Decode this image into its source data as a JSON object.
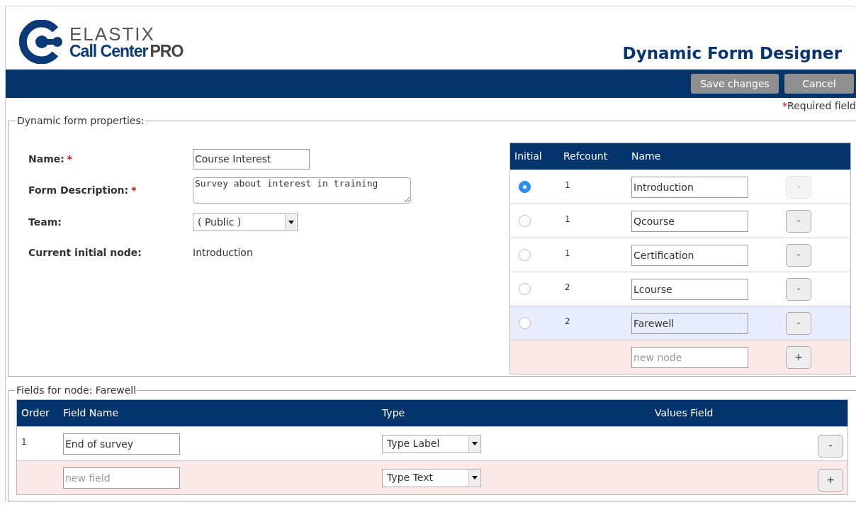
{
  "logo": {
    "brand": "ELASTIX",
    "product": "Call Center",
    "edition": "PRO"
  },
  "title": "Dynamic Form Designer",
  "buttons": [
    {
      "label": "Save changes",
      "kind": "save"
    },
    {
      "label": "Cancel",
      "kind": "cancel"
    }
  ],
  "required_note": {
    "mark": "*",
    "text": "Required field"
  },
  "properties": {
    "legend": "Dynamic form properties:",
    "fields": [
      {
        "kind": "text",
        "label": "Name:",
        "required": true,
        "value": "Course Interest"
      },
      {
        "kind": "textarea",
        "label": "Form Description:",
        "required": true,
        "value": "Survey about interest in training"
      },
      {
        "kind": "select",
        "label": "Team:",
        "required": false,
        "value": "( Public )"
      },
      {
        "kind": "static",
        "label": "Current initial node:",
        "required": false,
        "value": "Introduction"
      }
    ]
  },
  "nodes_table": {
    "columns": [
      "Initial",
      "Refcount",
      "Name"
    ],
    "rows": [
      {
        "initial": true,
        "refcount": "1",
        "name": "Introduction",
        "selected": false,
        "remove_disabled": true,
        "remove_label": "-"
      },
      {
        "initial": false,
        "refcount": "1",
        "name": "Qcourse",
        "selected": false,
        "remove_disabled": false,
        "remove_label": "-"
      },
      {
        "initial": false,
        "refcount": "1",
        "name": "Certification",
        "selected": false,
        "remove_disabled": false,
        "remove_label": "-"
      },
      {
        "initial": false,
        "refcount": "2",
        "name": "Lcourse",
        "selected": false,
        "remove_disabled": false,
        "remove_label": "-"
      },
      {
        "initial": false,
        "refcount": "2",
        "name": "Farewell",
        "selected": true,
        "remove_disabled": false,
        "remove_label": "-"
      }
    ],
    "new_row": {
      "placeholder": "new node",
      "add_label": "+"
    }
  },
  "fields_section": {
    "legend": "Fields for node: Farewell",
    "columns": [
      "Order",
      "Field Name",
      "Type",
      "Values Field"
    ],
    "rows": [
      {
        "order": "1",
        "name": "End of survey",
        "type": "Type Label",
        "remove_label": "-"
      }
    ],
    "new_row": {
      "placeholder": "new field",
      "type": "Type Text",
      "add_label": "+"
    }
  }
}
